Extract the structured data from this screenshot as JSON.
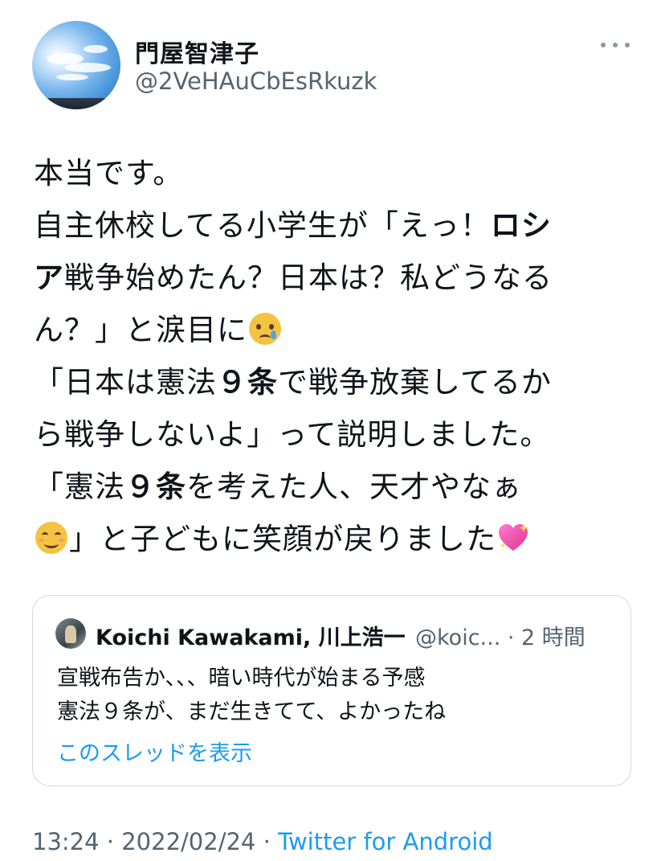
{
  "author": {
    "name": "門屋智津子",
    "handle": "@2VeHAuCbEsRkuzk"
  },
  "tweet": {
    "lines": [
      [
        {
          "t": "本当です。"
        }
      ],
      [
        {
          "t": "自主休校してる小学生が「えっ！"
        },
        {
          "t": "ロシ",
          "b": true
        }
      ],
      [
        {
          "t": "ア",
          "b": true
        },
        {
          "t": "戦争始めたん？日本は？私どうなる"
        }
      ],
      [
        {
          "t": "ん？」と涙目に"
        },
        {
          "e": "crying-face-emoji"
        }
      ],
      [
        {
          "t": "「日本は憲法"
        },
        {
          "t": "９条",
          "b": true
        },
        {
          "t": "で戦争放棄してるか"
        }
      ],
      [
        {
          "t": "ら戦争しないよ」って説明しました。"
        }
      ],
      [
        {
          "t": "「憲法"
        },
        {
          "t": "９条",
          "b": true
        },
        {
          "t": "を考えた人、天才やなぁ"
        }
      ],
      [
        {
          "e": "smiling-face-emoji"
        },
        {
          "t": "」と子どもに笑顔が戻りました"
        },
        {
          "e": "sparkling-heart-emoji"
        }
      ]
    ]
  },
  "quoted": {
    "name": "Koichi Kawakami, 川上浩一",
    "handle": "@koic... · 2 時間",
    "lines": [
      "宣戦布告か、、、暗い時代が始まる予感",
      "憲法９条が、まだ生きてて、よかったね"
    ],
    "link": "このスレッドを表示"
  },
  "footer": {
    "time": "13:24 · 2022/02/24 · ",
    "source": "Twitter for Android"
  },
  "colors": {
    "link": "#1d9bf0",
    "secondary": "#536471",
    "border": "#cfd9de"
  }
}
